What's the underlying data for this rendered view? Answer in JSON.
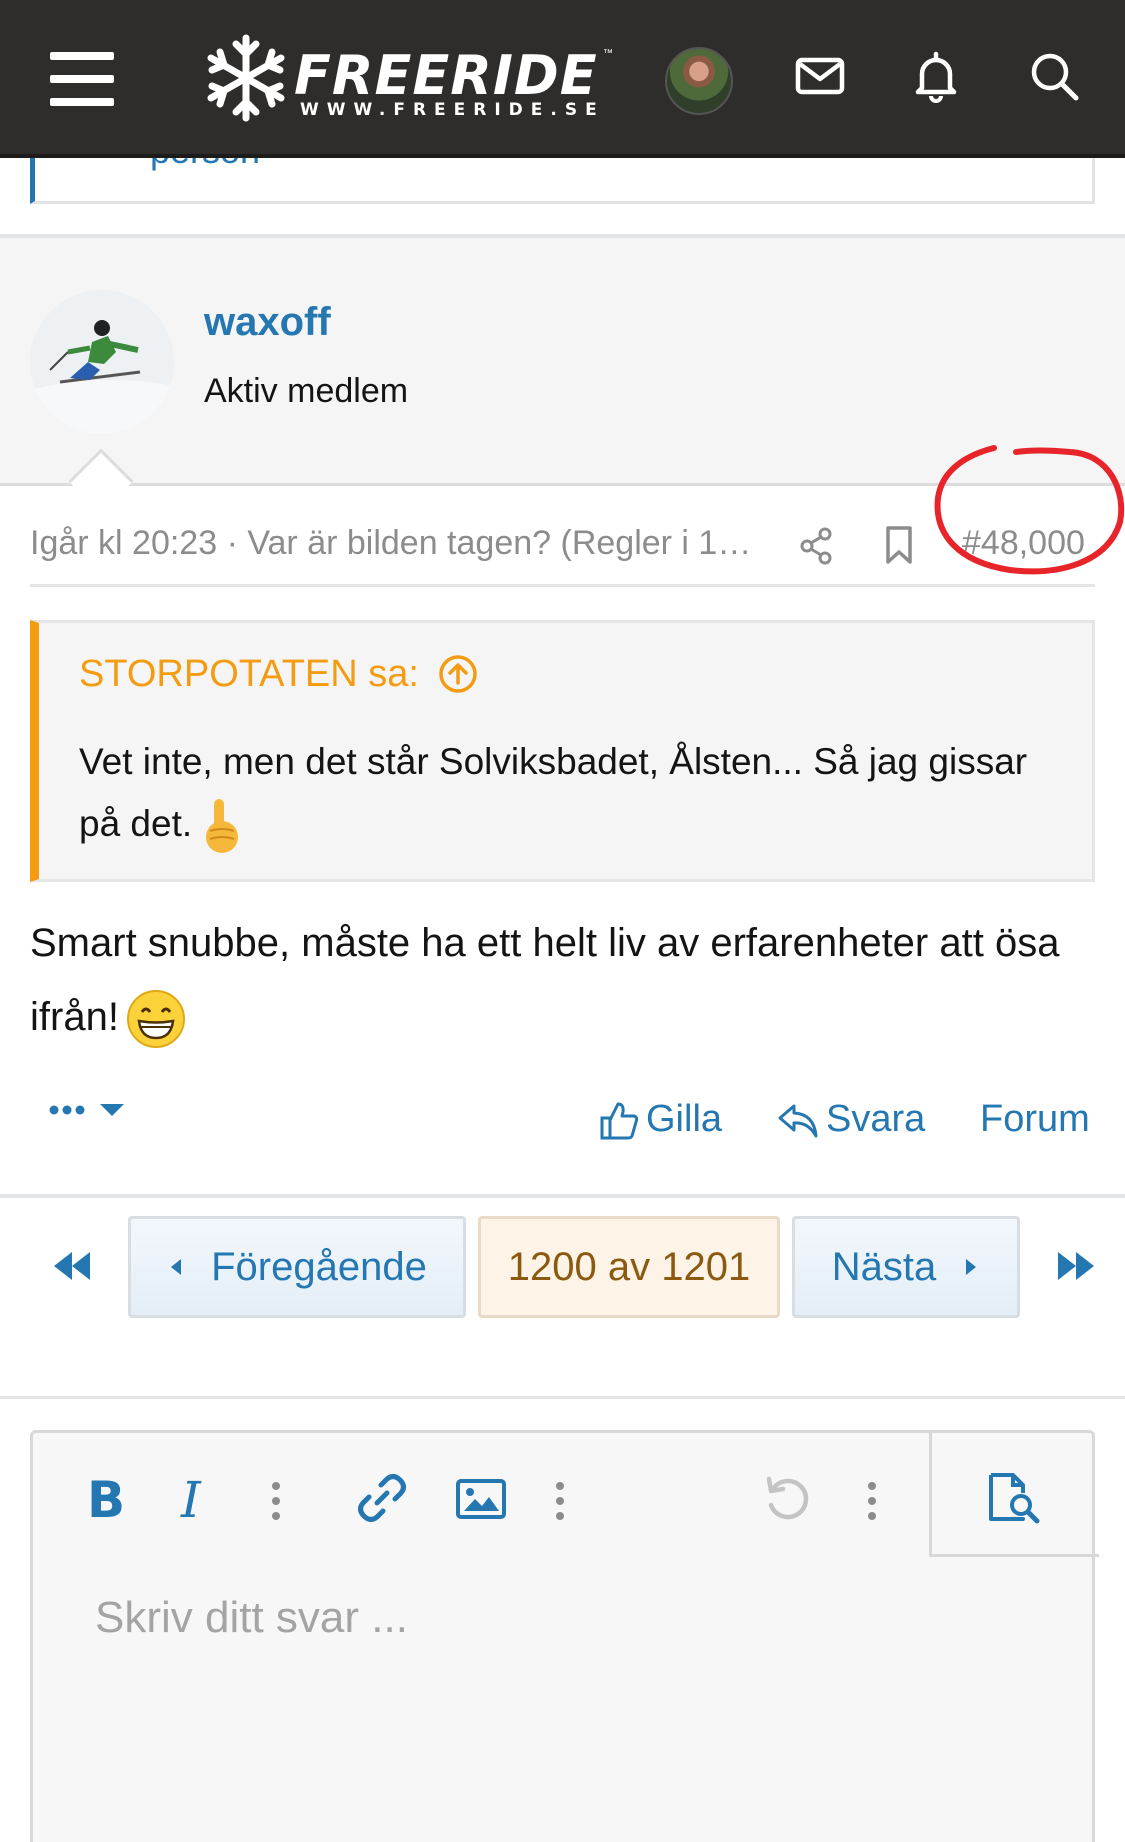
{
  "header": {
    "logo_word": "FREERIDE",
    "logo_url": "WWW.FREERIDE.SE",
    "logo_tm": "™"
  },
  "prev_post": {
    "tail_text": "person"
  },
  "post": {
    "username": "waxoff",
    "user_title": "Aktiv medlem",
    "timestamp": "Igår kl 20:23",
    "thread_title": "Var är bilden tagen? (Regler i 1…",
    "post_number": "#48,000",
    "quote": {
      "author": "STORPOTATEN sa:",
      "text": "Vet inte, men det står Solviksbadet, Ålsten... Så jag gissar på det."
    },
    "body": "Smart snubbe, måste ha ett helt liv av erfarenheter att ösa ifrån!",
    "actions": {
      "like": "Gilla",
      "reply": "Svara",
      "forum": "Forum"
    }
  },
  "pagination": {
    "prev": "Föregående",
    "current": "1200 av 1201",
    "next": "Nästa"
  },
  "editor": {
    "placeholder": "Skriv ditt svar ..."
  },
  "colors": {
    "header_bg": "#2e2d2b",
    "link_blue": "#2577b1",
    "quote_orange": "#f39c12",
    "highlight_red": "#e8242b"
  }
}
